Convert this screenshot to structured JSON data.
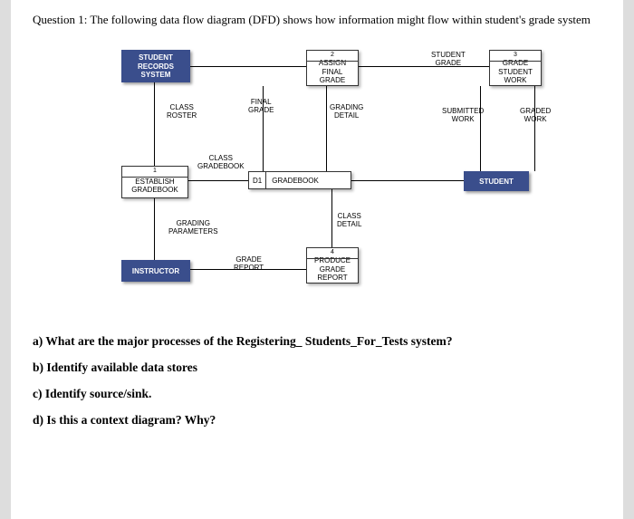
{
  "question_header": "Question 1: The following data flow diagram (DFD) shows how information might flow within student's grade system",
  "entities": {
    "student_records": "STUDENT\nRECORDS\nSYSTEM",
    "instructor": "INSTRUCTOR",
    "student": "STUDENT"
  },
  "processes": {
    "p1": {
      "num": "1",
      "label": "ESTABLISH\nGRADEBOOK"
    },
    "p2": {
      "num": "2",
      "label": "ASSIGN\nFINAL\nGRADE"
    },
    "p3": {
      "num": "3",
      "label": "GRADE\nSTUDENT\nWORK"
    },
    "p4": {
      "num": "4",
      "label": "PRODUCE\nGRADE\nREPORT"
    }
  },
  "datastore": {
    "id": "D1",
    "name": "GRADEBOOK"
  },
  "flows": {
    "class_roster": "CLASS\nROSTER",
    "final_grade": "FINAL\nGRADE",
    "grading_detail": "GRADING\nDETAIL",
    "student_grade": "STUDENT\nGRADE",
    "submitted_work": "SUBMITTED\nWORK",
    "graded_work": "GRADED\nWORK",
    "class_gradebook": "CLASS\nGRADEBOOK",
    "grading_parameters": "GRADING\nPARAMETERS",
    "grade_report": "GRADE\nREPORT",
    "class_detail": "CLASS\nDETAIL"
  },
  "subquestions": {
    "a": "a) What are the major processes of the Registering_ Students_For_Tests system?",
    "b": "b) Identify available data stores",
    "c": "c) Identify source/sink.",
    "d": "d) Is this a context diagram? Why?"
  }
}
